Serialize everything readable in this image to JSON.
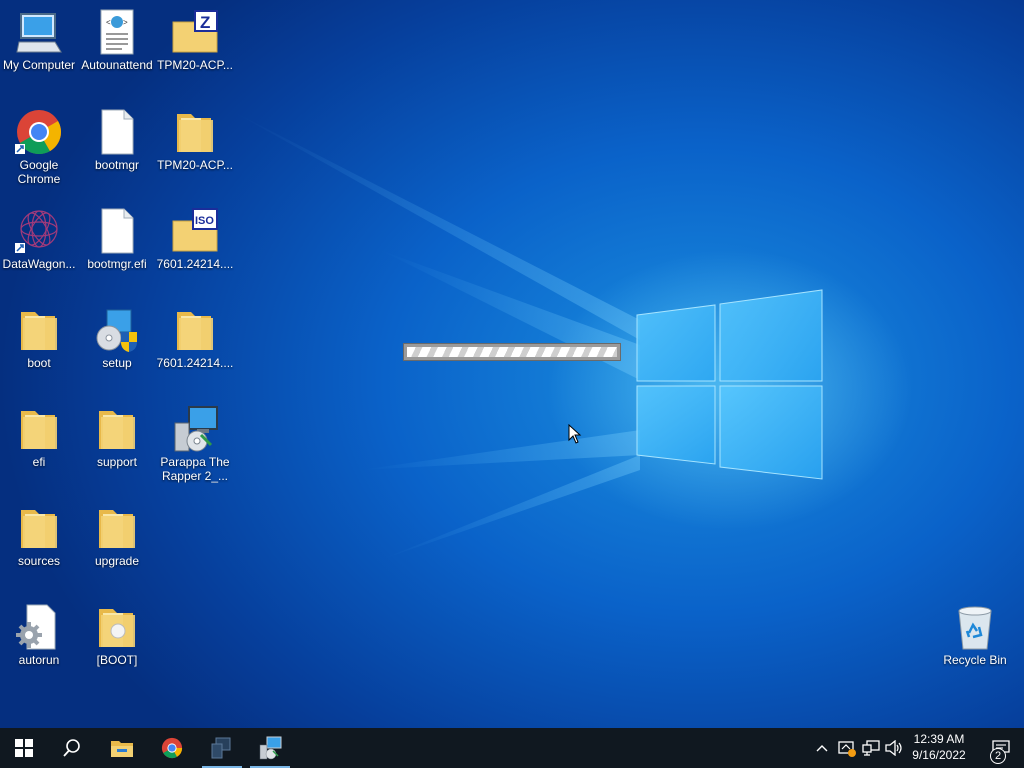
{
  "desktop": {
    "icons": [
      {
        "label": "My Computer",
        "icon": "computer-icon"
      },
      {
        "label": "Autounattend",
        "icon": "xml-document-icon"
      },
      {
        "label": "TPM20-ACP...",
        "icon": "zip-folder-icon"
      },
      {
        "label": "Google Chrome",
        "icon": "chrome-icon"
      },
      {
        "label": "bootmgr",
        "icon": "file-icon"
      },
      {
        "label": "TPM20-ACP...",
        "icon": "folder-icon"
      },
      {
        "label": "DataWagon...",
        "icon": "datawagon-icon"
      },
      {
        "label": "bootmgr.efi",
        "icon": "file-icon"
      },
      {
        "label": "7601.24214....",
        "icon": "iso-folder-icon"
      },
      {
        "label": "boot",
        "icon": "folder-icon"
      },
      {
        "label": "setup",
        "icon": "setup-icon"
      },
      {
        "label": "7601.24214....",
        "icon": "folder-icon"
      },
      {
        "label": "efi",
        "icon": "folder-icon"
      },
      {
        "label": "support",
        "icon": "folder-icon"
      },
      {
        "label": "Parappa The Rapper 2_...",
        "icon": "installer-icon"
      },
      {
        "label": "sources",
        "icon": "folder-icon"
      },
      {
        "label": "upgrade",
        "icon": "folder-icon"
      },
      {
        "label": "autorun",
        "icon": "settings-file-icon"
      },
      {
        "label": "[BOOT]",
        "icon": "folder-icon"
      },
      {
        "label": "Recycle Bin",
        "icon": "recycle-bin-icon"
      }
    ]
  },
  "progress": {
    "state": "indeterminate"
  },
  "taskbar": {
    "clock_time": "12:39 AM",
    "clock_date": "9/16/2022",
    "notification_count": "2"
  },
  "colors": {
    "taskbar": "#101820",
    "desktop_accent": "#0a62c9",
    "folder": "#f3d173"
  }
}
